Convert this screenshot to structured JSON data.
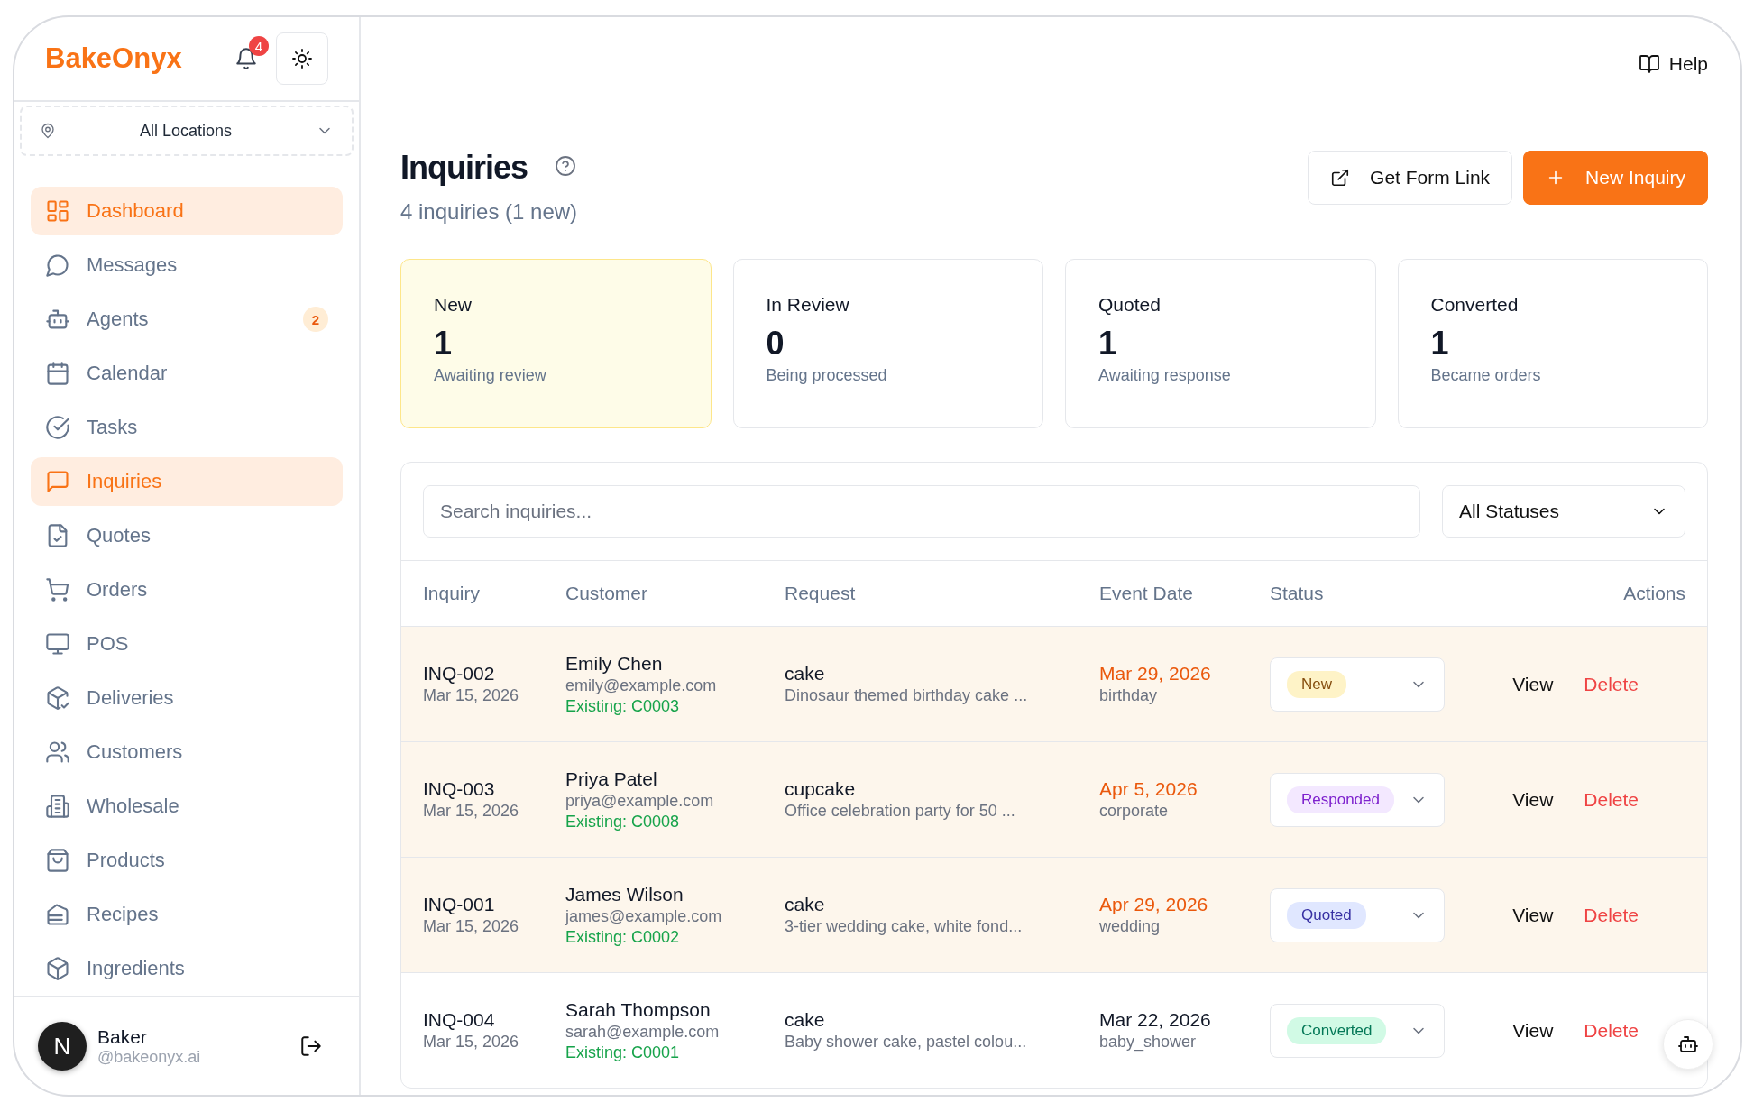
{
  "sidebar": {
    "logo": "BakeOnyx",
    "notification_count": "4",
    "location": "All Locations",
    "items": [
      {
        "label": "Dashboard",
        "selected": true
      },
      {
        "label": "Messages",
        "selected": false
      },
      {
        "label": "Agents",
        "selected": false,
        "badge": "2"
      },
      {
        "label": "Calendar",
        "selected": false
      },
      {
        "label": "Tasks",
        "selected": false
      },
      {
        "label": "Inquiries",
        "selected": true
      },
      {
        "label": "Quotes",
        "selected": false
      },
      {
        "label": "Orders",
        "selected": false
      },
      {
        "label": "POS",
        "selected": false
      },
      {
        "label": "Deliveries",
        "selected": false
      },
      {
        "label": "Customers",
        "selected": false
      },
      {
        "label": "Wholesale",
        "selected": false
      },
      {
        "label": "Products",
        "selected": false
      },
      {
        "label": "Recipes",
        "selected": false
      },
      {
        "label": "Ingredients",
        "selected": false
      }
    ],
    "user": {
      "avatar": "N",
      "name": "Baker",
      "email": "@bakeonyx.ai"
    }
  },
  "header": {
    "help": "Help"
  },
  "page": {
    "title": "Inquiries",
    "subtitle": "4 inquiries (1 new)",
    "buttons": [
      {
        "label": "Get Form Link",
        "kind": "secondary"
      },
      {
        "label": "New Inquiry",
        "kind": "primary"
      }
    ]
  },
  "stats": [
    {
      "label": "New",
      "value": "1",
      "caption": "Awaiting review",
      "highlighted": true
    },
    {
      "label": "In Review",
      "value": "0",
      "caption": "Being processed",
      "highlighted": false
    },
    {
      "label": "Quoted",
      "value": "1",
      "caption": "Awaiting response",
      "highlighted": false
    },
    {
      "label": "Converted",
      "value": "1",
      "caption": "Became orders",
      "highlighted": false
    }
  ],
  "filters": {
    "search_placeholder": "Search inquiries...",
    "status": "All Statuses"
  },
  "table": {
    "columns": [
      "Inquiry",
      "Customer",
      "Request",
      "Event Date",
      "Status",
      "Actions"
    ],
    "rows": [
      {
        "id": "INQ-002",
        "created": "Mar 15, 2026",
        "customer": "Emily Chen",
        "email": "emily@example.com",
        "existing": "Existing: C0003",
        "request": "cake",
        "description": "Dinosaur themed birthday cake ...",
        "event_date": "Mar 29, 2026",
        "event_type": "birthday",
        "date_highlighted": true,
        "highlighted": true,
        "status": {
          "label": "New",
          "kind": "new"
        },
        "actions": [
          "View",
          "Delete"
        ]
      },
      {
        "id": "INQ-003",
        "created": "Mar 15, 2026",
        "customer": "Priya Patel",
        "email": "priya@example.com",
        "existing": "Existing: C0008",
        "request": "cupcake",
        "description": "Office celebration party for 50 ...",
        "event_date": "Apr 5, 2026",
        "event_type": "corporate",
        "date_highlighted": true,
        "highlighted": true,
        "status": {
          "label": "Responded",
          "kind": "responded"
        },
        "actions": [
          "View",
          "Delete"
        ]
      },
      {
        "id": "INQ-001",
        "created": "Mar 15, 2026",
        "customer": "James Wilson",
        "email": "james@example.com",
        "existing": "Existing: C0002",
        "request": "cake",
        "description": "3-tier wedding cake, white fond...",
        "event_date": "Apr 29, 2026",
        "event_type": "wedding",
        "date_highlighted": true,
        "highlighted": true,
        "status": {
          "label": "Quoted",
          "kind": "quoted"
        },
        "actions": [
          "View",
          "Delete"
        ]
      },
      {
        "id": "INQ-004",
        "created": "Mar 15, 2026",
        "customer": "Sarah Thompson",
        "email": "sarah@example.com",
        "existing": "Existing: C0001",
        "request": "cake",
        "description": "Baby shower cake, pastel colou...",
        "event_date": "Mar 22, 2026",
        "event_type": "baby_shower",
        "date_highlighted": false,
        "highlighted": false,
        "status": {
          "label": "Converted",
          "kind": "converted"
        },
        "actions": [
          "View",
          "Delete"
        ]
      }
    ]
  }
}
